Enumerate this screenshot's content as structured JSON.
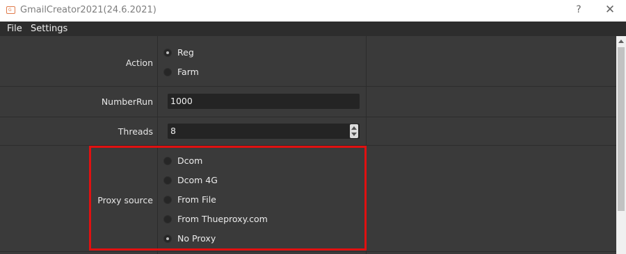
{
  "window": {
    "title": "GmailCreator2021(24.6.2021)",
    "icon_text": "G",
    "help": "?",
    "close": "✕"
  },
  "menu": [
    {
      "label": "File"
    },
    {
      "label": "Settings"
    }
  ],
  "form": {
    "action": {
      "label": "Action",
      "options": [
        {
          "label": "Reg",
          "checked": true
        },
        {
          "label": "Farm",
          "checked": false
        }
      ]
    },
    "number_run": {
      "label": "NumberRun",
      "value": "1000"
    },
    "threads": {
      "label": "Threads",
      "value": "8"
    },
    "proxy_source": {
      "label": "Proxy source",
      "options": [
        {
          "label": "Dcom",
          "checked": false
        },
        {
          "label": "Dcom 4G",
          "checked": false
        },
        {
          "label": "From File",
          "checked": false
        },
        {
          "label": "From Thueproxy.com",
          "checked": false
        },
        {
          "label": "No Proxy",
          "checked": true
        }
      ]
    }
  },
  "colors": {
    "highlight": "#e01010",
    "background": "#3a3a3a",
    "menubar": "#2d2d2d"
  }
}
